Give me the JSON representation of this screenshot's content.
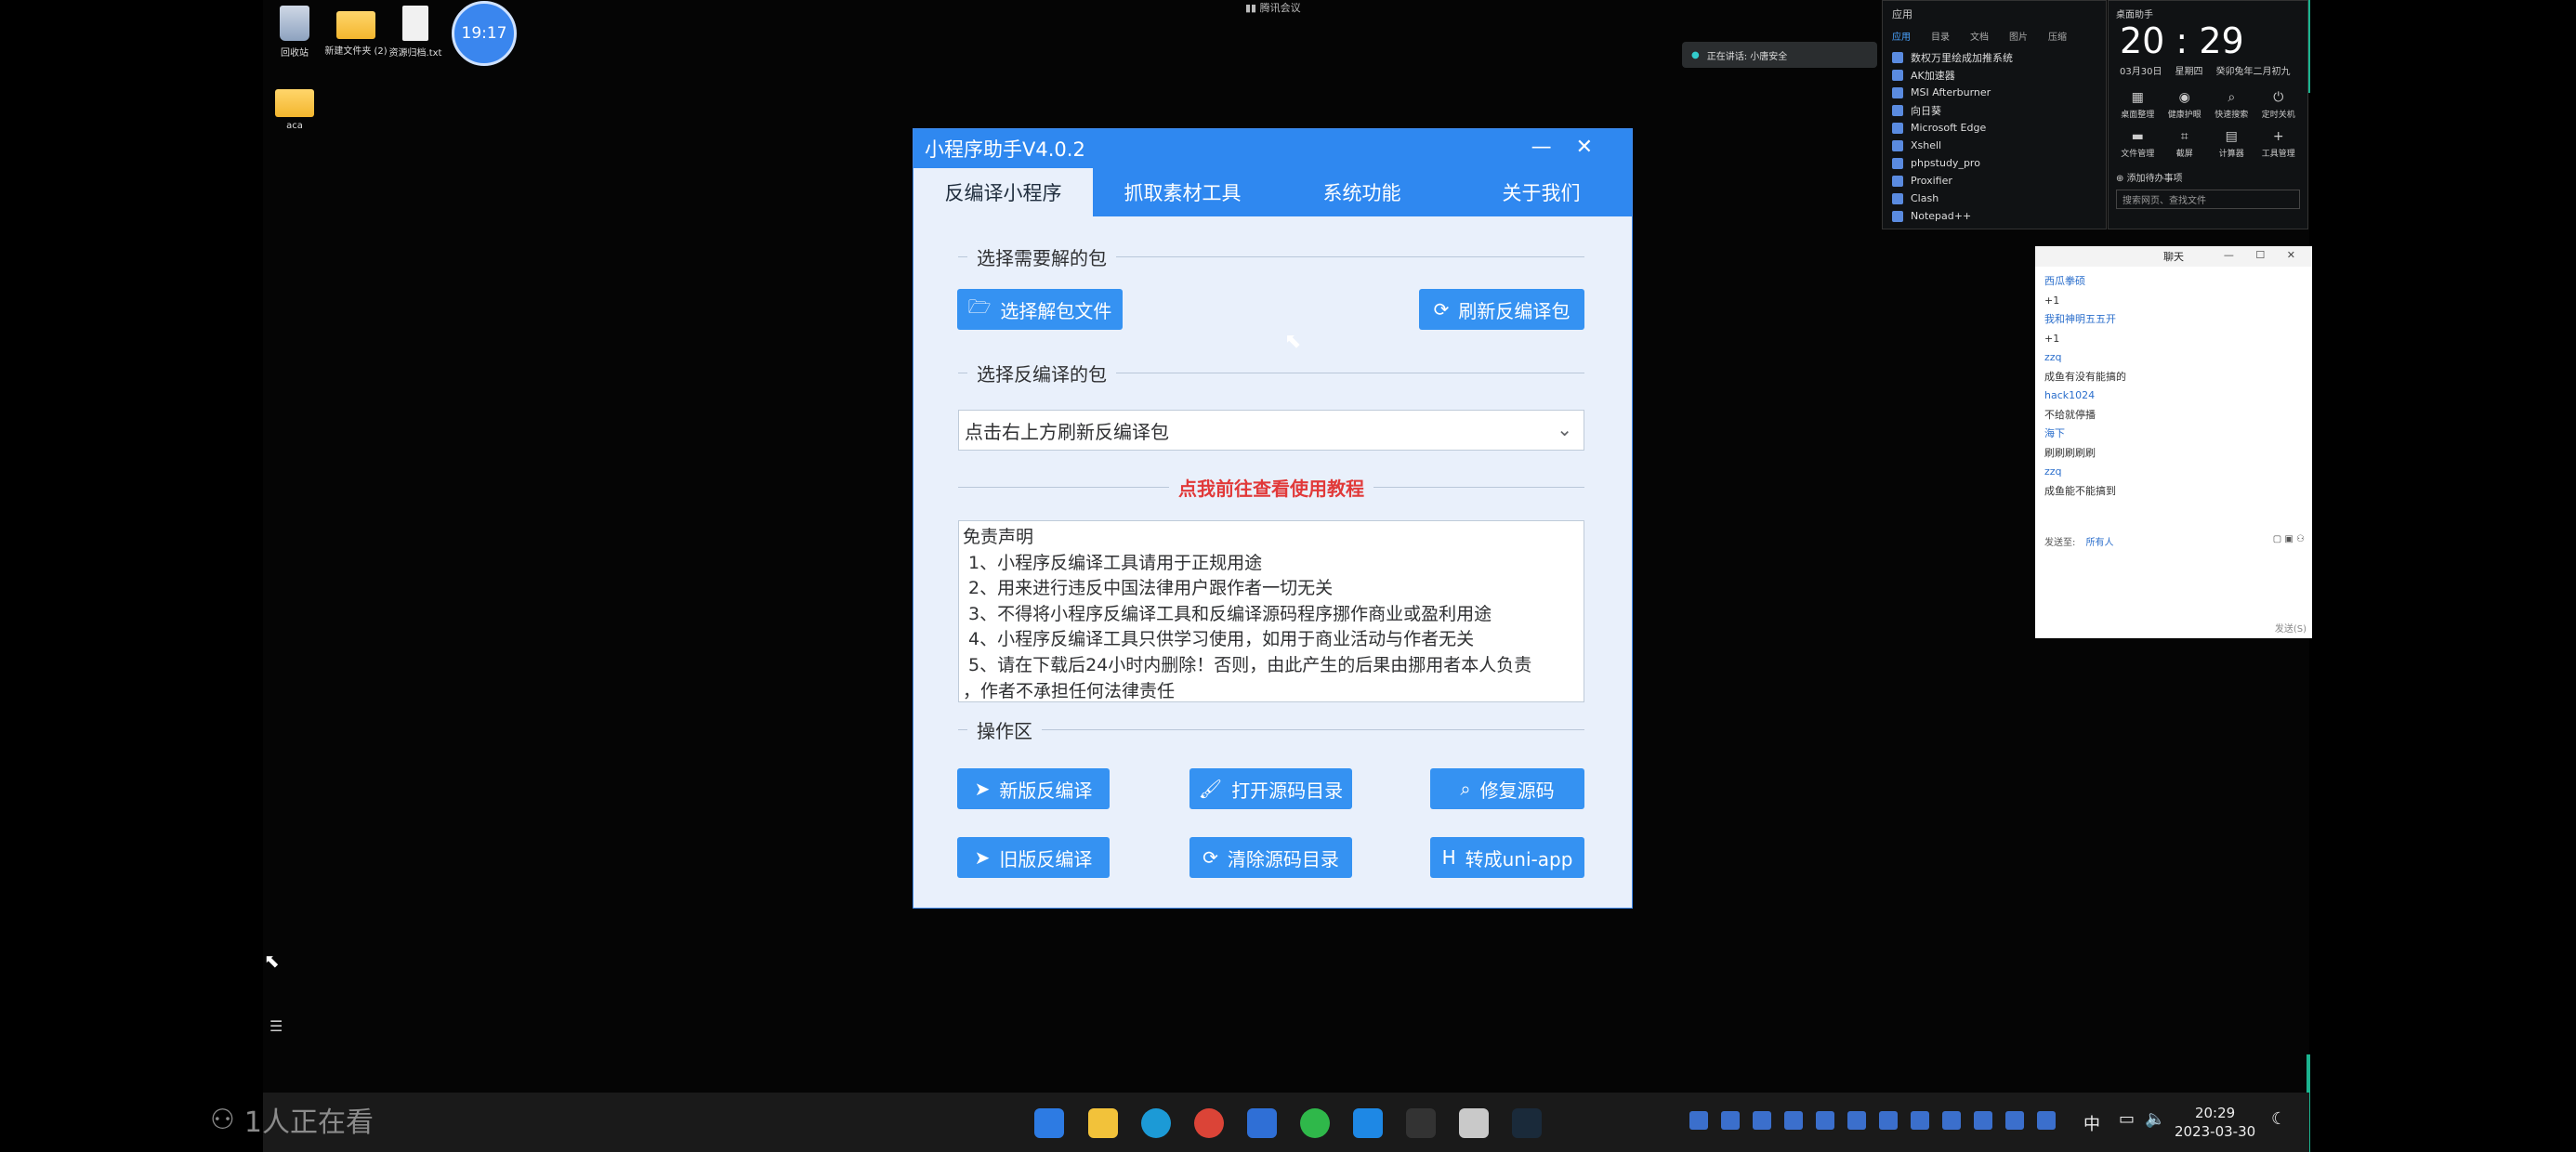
{
  "desktop": {
    "icons": [
      {
        "label": "回收站",
        "icon": "recycle-bin-icon"
      },
      {
        "label": "新建文件夹 (2)",
        "icon": "folder-icon"
      },
      {
        "label": "资源归档.txt",
        "icon": "text-file-icon"
      },
      {
        "label": "aca",
        "icon": "folder-icon"
      }
    ],
    "clock_bubble": "19:17",
    "top_indicator": "腾讯会议",
    "notify_text": "正在讲话: 小唐安全"
  },
  "apps_panel": {
    "title": "应用",
    "tabs": [
      "应用",
      "目录",
      "文档",
      "图片",
      "压缩"
    ],
    "items": [
      "数权万里绘成加推系统",
      "AK加速器",
      "MSI Afterburner",
      "向日葵",
      "Microsoft Edge",
      "Xshell",
      "phpstudy_pro",
      "Proxifier",
      "Clash",
      "Notepad++"
    ]
  },
  "desk_helper": {
    "title": "桌面助手",
    "time": "20 : 29",
    "date": "03月30日",
    "weekday": "星期四",
    "lunar": "癸卯兔年二月初九",
    "shortcuts": [
      "桌面整理",
      "健康护眼",
      "快速搜索",
      "定时关机",
      "文件管理",
      "截屏",
      "计算器",
      "工具管理"
    ],
    "todo": "添加待办事项",
    "search_placeholder": "搜索网页、查找文件"
  },
  "chat": {
    "title": "聊天",
    "messages": [
      {
        "user": "西瓜拳硕",
        "text": "+1"
      },
      {
        "user": "我和神明五五开",
        "text": "+1"
      },
      {
        "user": "zzq",
        "text": "成鱼有没有能搞的"
      },
      {
        "user": "hack1024",
        "text": "不给就停播"
      },
      {
        "user": "海下",
        "text": "刷刷刷刷刷"
      },
      {
        "user": "zzq",
        "text": "成鱼能不能搞到"
      }
    ],
    "send_to_label": "发送至:",
    "send_to_value": "所有人",
    "send_button": "发送(S)"
  },
  "app": {
    "title": "小程序助手V4.0.2",
    "tabs": [
      "反编译小程序",
      "抓取素材工具",
      "系统功能",
      "关于我们"
    ],
    "section1": "选择需要解的包",
    "btn_select_file": "选择解包文件",
    "btn_refresh": "刷新反编译包",
    "section2": "选择反编译的包",
    "select_placeholder": "点击右上方刷新反编译包",
    "tutorial_link": "点我前往查看使用教程",
    "disclaimer": [
      "免责声明",
      "1、小程序反编译工具请用于正规用途",
      "2、用来进行违反中国法律用户跟作者一切无关",
      "3、不得将小程序反编译工具和反编译源码程序挪作商业或盈利用途",
      "4、小程序反编译工具只供学习使用，如用于商业活动与作者无关",
      "5、请在下载后24小时内删除！否则，由此产生的后果由挪用者本人负责",
      "，作者不承担任何法律责任"
    ],
    "section3": "操作区",
    "ops": [
      {
        "label": "新版反编译",
        "icon": "paper-plane-icon"
      },
      {
        "label": "打开源码目录",
        "icon": "brush-icon"
      },
      {
        "label": "修复源码",
        "icon": "search-icon"
      },
      {
        "label": "旧版反编译",
        "icon": "paper-plane-icon"
      },
      {
        "label": "清除源码目录",
        "icon": "refresh-icon"
      },
      {
        "label": "转成uni-app",
        "icon": "h-icon"
      }
    ]
  },
  "taskbar": {
    "viewer_text": "1人正在看",
    "time": "20:29",
    "date": "2023-03-30",
    "ime": "中"
  },
  "colors": {
    "accent": "#2f88f0",
    "button": "#3592f2",
    "link_red": "#e13939",
    "window_bg": "#e9f0fb"
  }
}
